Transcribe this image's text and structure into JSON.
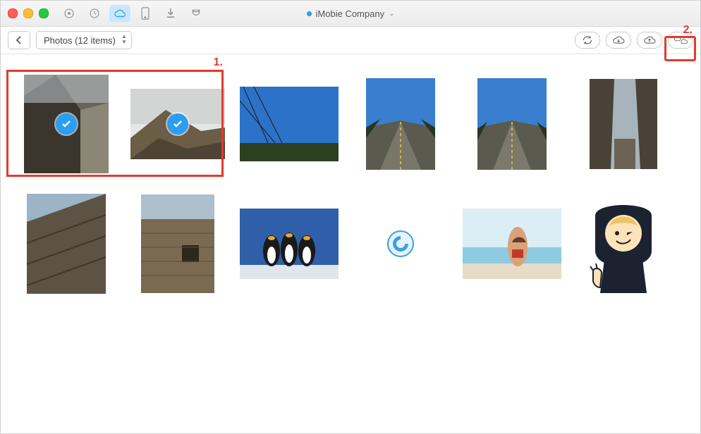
{
  "title": {
    "account": "iMobie Company"
  },
  "toolbar": {
    "selector_label": "Photos (12 items)",
    "icons": {
      "music": "music-icon",
      "history": "history-icon",
      "cloud": "cloud-icon",
      "phone": "phone-icon",
      "download": "download-icon",
      "shirt": "toolbox-icon"
    }
  },
  "actions": {
    "refresh": "refresh-icon",
    "cloud_download": "cloud-download-icon",
    "cloud_upload": "cloud-upload-icon",
    "cloud_sync": "cloud-to-cloud-icon"
  },
  "callouts": {
    "one": "1.",
    "two": "2."
  },
  "photos": [
    {
      "selected": true,
      "desc": "stone tower silhouette"
    },
    {
      "selected": true,
      "desc": "mountain under clouds"
    },
    {
      "selected": false,
      "desc": "blue sky over trees"
    },
    {
      "selected": false,
      "desc": "straight highway with trees"
    },
    {
      "selected": false,
      "desc": "straight highway blue sky"
    },
    {
      "selected": false,
      "desc": "narrow stone alley"
    },
    {
      "selected": false,
      "desc": "stone wall looking up"
    },
    {
      "selected": false,
      "desc": "brick tower wall"
    },
    {
      "selected": false,
      "desc": "three penguins"
    },
    {
      "selected": false,
      "desc": "app logo round blue"
    },
    {
      "selected": false,
      "desc": "woman on beach"
    },
    {
      "selected": false,
      "desc": "anime hooded character"
    }
  ]
}
